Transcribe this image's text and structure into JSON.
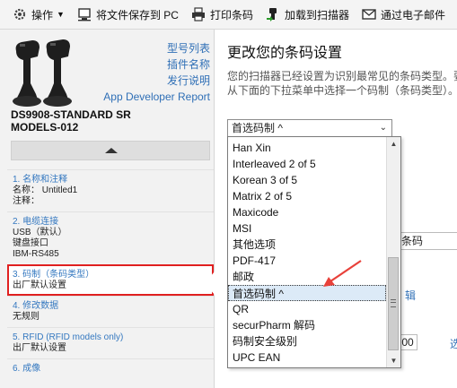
{
  "toolbar": {
    "items": [
      {
        "label": "操作",
        "has_arrow": true
      },
      {
        "label": "将文件保存到 PC"
      },
      {
        "label": "打印条码"
      },
      {
        "label": "加载到扫描器"
      },
      {
        "label": "通过电子邮件"
      }
    ]
  },
  "left": {
    "links": [
      "型号列表",
      "插件名称",
      "发行说明"
    ],
    "app_dev": "App Developer Report",
    "model_line1": "DS9908-STANDARD SR",
    "model_line2": "MODELS-012",
    "steps": [
      {
        "title": "1. 名称和注释",
        "lines": [
          "名称： Untitled1",
          "注释："
        ]
      },
      {
        "title": "2. 电缆连接",
        "lines": [
          "USB（默认）",
          "键盘接口",
          "IBM-RS485"
        ]
      },
      {
        "title": "3. 码制（条码类型）",
        "lines": [
          "出厂默认设置"
        ]
      },
      {
        "title": "4. 修改数据",
        "lines": [
          "无规则"
        ]
      },
      {
        "title": "5. RFID (RFID models only)",
        "lines": [
          "出厂默认设置"
        ]
      },
      {
        "title": "6. 成像",
        "lines": []
      }
    ]
  },
  "right": {
    "title": "更改您的条码设置",
    "desc_line1": "您的扫描器已经设置为识别最常见的条码类型。要",
    "desc_line2": "从下面的下拉菜单中选择一个码制（条码类型）。",
    "select_value": "首选码制 ^",
    "bg_field": "条码",
    "bg_link": "辑",
    "bg_num": "00",
    "bg_link2": "选"
  },
  "dropdown": {
    "options": [
      "Han Xin",
      "Interleaved 2 of 5",
      "Korean 3 of 5",
      "Matrix 2 of 5",
      "Maxicode",
      "MSI",
      "其他选项",
      "PDF-417",
      "邮政",
      "首选码制 ^",
      "QR",
      "securPharm 解码",
      "码制安全级别",
      "UPC EAN"
    ],
    "selected_index": 9
  },
  "colors": {
    "link": "#2f6fb6",
    "highlight_border": "#e02020",
    "arrow": "#e8413a"
  }
}
